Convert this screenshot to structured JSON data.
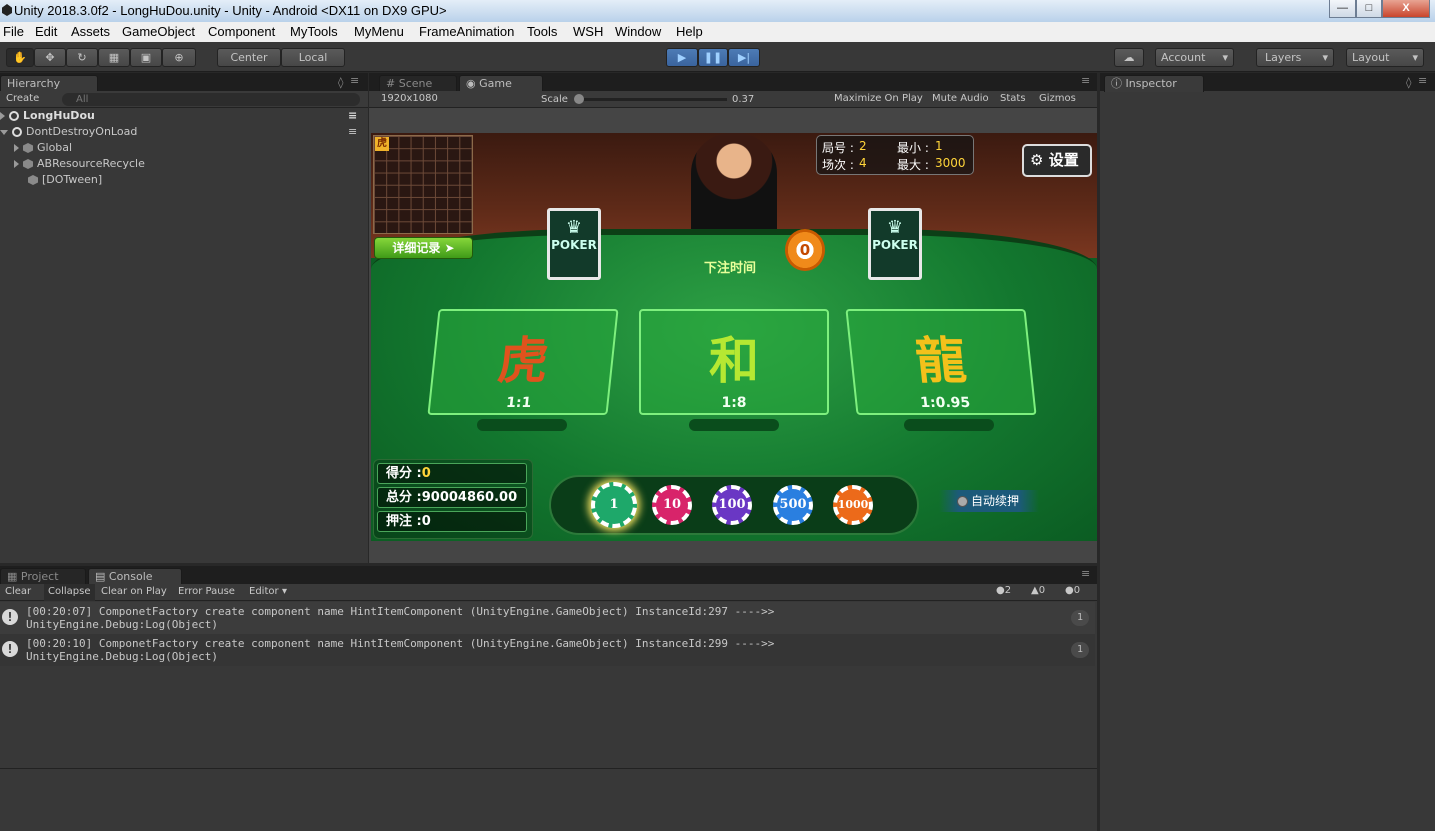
{
  "window": {
    "title": "Unity 2018.3.0f2 - LongHuDou.unity - Unity - Android <DX11 on DX9 GPU>",
    "minimize": "—",
    "maximize": "□",
    "close": "X"
  },
  "menu": [
    "File",
    "Edit",
    "Assets",
    "GameObject",
    "Component",
    "MyTools",
    "MyMenu",
    "FrameAnimation",
    "Tools",
    "WSH",
    "Window",
    "Help"
  ],
  "toolbar": {
    "center": "Center",
    "local": "Local",
    "account": "Account",
    "layers": "Layers",
    "layout": "Layout"
  },
  "hierarchy": {
    "tab": "Hierarchy",
    "create": "Create",
    "search_placeholder": "All",
    "items": [
      {
        "label": "LongHuDou"
      },
      {
        "label": "DontDestroyOnLoad"
      },
      {
        "label": "Global"
      },
      {
        "label": "ABResourceRecycle"
      },
      {
        "label": "[DOTween]"
      }
    ]
  },
  "tabs": {
    "scene": "Scene",
    "game": "Game",
    "inspector": "Inspector",
    "project": "Project",
    "console": "Console"
  },
  "game_toolbar": {
    "resolution": "1920x1080",
    "scale_label": "Scale",
    "scale_value": "0.37",
    "maximize": "Maximize On Play",
    "mute": "Mute Audio",
    "stats": "Stats",
    "gizmos": "Gizmos"
  },
  "game": {
    "tiger_tag": "虎",
    "detail_button": "详细记录 ➤",
    "info": {
      "round_label": "局号 :",
      "round": "2",
      "session_label": "场次 :",
      "session": "4",
      "min_label": "最小 :",
      "min": "1",
      "max_label": "最大 :",
      "max": "3000"
    },
    "settings": "设置",
    "card_text": "POKER",
    "timer": "0",
    "bet_time": "下注时间",
    "areas": [
      {
        "glyph": "虎",
        "odds": "1:1",
        "color": "#e0531d"
      },
      {
        "glyph": "和",
        "odds": "1:8",
        "color": "#b6e832"
      },
      {
        "glyph": "龍",
        "odds": "1:0.95",
        "color": "#f3c11b"
      }
    ],
    "score_label": "得分 :",
    "score": "0",
    "total_label": "总分 :",
    "total": "90004860.00",
    "bet_label": "押注 :",
    "bet": "0",
    "chips": [
      {
        "value": "1",
        "color": "#1ea86a"
      },
      {
        "value": "10",
        "color": "#d8246a"
      },
      {
        "value": "100",
        "color": "#6a37c4"
      },
      {
        "value": "500",
        "color": "#2a7fe0"
      },
      {
        "value": "1000",
        "color": "#ec6a1a"
      }
    ],
    "auto_bet": "自动续押"
  },
  "console": {
    "clear": "Clear",
    "collapse": "Collapse",
    "clear_on_play": "Clear on Play",
    "error_pause": "Error Pause",
    "editor": "Editor",
    "counts": {
      "log": "2",
      "warn": "0",
      "error": "0"
    },
    "logs": [
      {
        "line1": "[00:20:07] ComponetFactory create component name HintItemComponent (UnityEngine.GameObject)  InstanceId:297 ---->>",
        "line2": "UnityEngine.Debug:Log(Object)",
        "count": "1"
      },
      {
        "line1": "[00:20:10] ComponetFactory create component name HintItemComponent (UnityEngine.GameObject)  InstanceId:299 ---->>",
        "line2": "UnityEngine.Debug:Log(Object)",
        "count": "1"
      }
    ]
  }
}
